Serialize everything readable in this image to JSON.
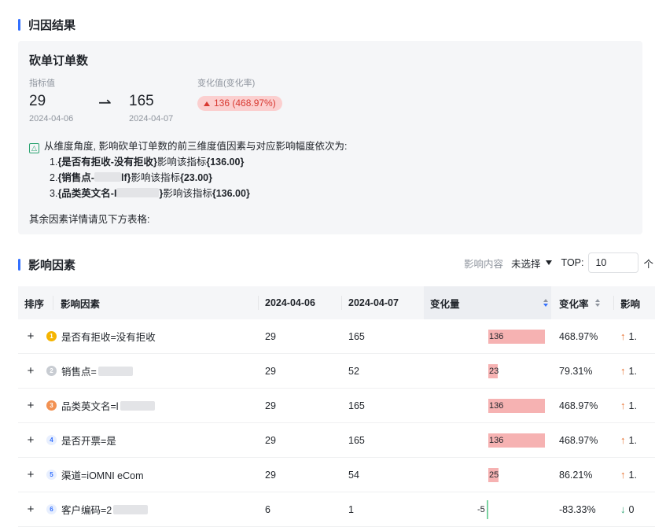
{
  "sections": {
    "attribution_title": "归因结果",
    "factors_title": "影响因素"
  },
  "summary": {
    "metric_name": "砍单订单数",
    "value_label": "指标值",
    "change_label": "变化值(变化率)",
    "start_value": "29",
    "end_value": "165",
    "start_date": "2024-04-06",
    "end_date": "2024-04-07",
    "change_badge": "136 (468.97%)",
    "insight_intro": "从维度角度, 影响砍单订单数的前三维度值因素与对应影响幅度依次为:",
    "insights": [
      {
        "prefix": "1.",
        "factor": "{是否有拒收-没有拒收}",
        "suffix": "影响该指标",
        "value": "{136.00}"
      },
      {
        "prefix": "2.",
        "factor": "{销售点-",
        "tail": "lf}",
        "suffix": "影响该指标",
        "value": "{23.00}"
      },
      {
        "prefix": "3.",
        "factor": "{品类英文名-I",
        "tail": "}",
        "suffix": "影响该指标",
        "value": "{136.00}"
      }
    ],
    "rest_note": "其余因素详情请见下方表格:"
  },
  "toolbar": {
    "content_label": "影响内容",
    "select_value": "未选择",
    "top_label": "TOP:",
    "top_value": "10",
    "unit": "个"
  },
  "table": {
    "headers": {
      "rank": "排序",
      "factor": "影响因素",
      "d1": "2024-04-06",
      "d2": "2024-04-07",
      "delta": "变化量",
      "rate": "变化率",
      "impact": "影响"
    },
    "rows": [
      {
        "factor": "是否有拒收=没有拒收",
        "v1": "29",
        "v2": "165",
        "delta": "136",
        "delta_num": 136,
        "rate": "468.97%",
        "impact": "1.",
        "trend": "up"
      },
      {
        "factor": "销售点=",
        "v1": "29",
        "v2": "52",
        "delta": "23",
        "delta_num": 23,
        "rate": "79.31%",
        "impact": "1.",
        "trend": "up"
      },
      {
        "factor": "品类英文名=l",
        "v1": "29",
        "v2": "165",
        "delta": "136",
        "delta_num": 136,
        "rate": "468.97%",
        "impact": "1.",
        "trend": "up"
      },
      {
        "factor": "是否开票=是",
        "v1": "29",
        "v2": "165",
        "delta": "136",
        "delta_num": 136,
        "rate": "468.97%",
        "impact": "1.",
        "trend": "up"
      },
      {
        "factor": "渠道=iOMNI eCom",
        "v1": "29",
        "v2": "54",
        "delta": "25",
        "delta_num": 25,
        "rate": "86.21%",
        "impact": "1.",
        "trend": "up"
      },
      {
        "factor": "客户编码=2",
        "v1": "6",
        "v2": "1",
        "delta": "-5",
        "delta_num": -5,
        "rate": "-83.33%",
        "impact": "0",
        "trend": "down"
      }
    ],
    "rank_labels": [
      "1",
      "2",
      "3",
      "4",
      "5",
      "6"
    ]
  }
}
